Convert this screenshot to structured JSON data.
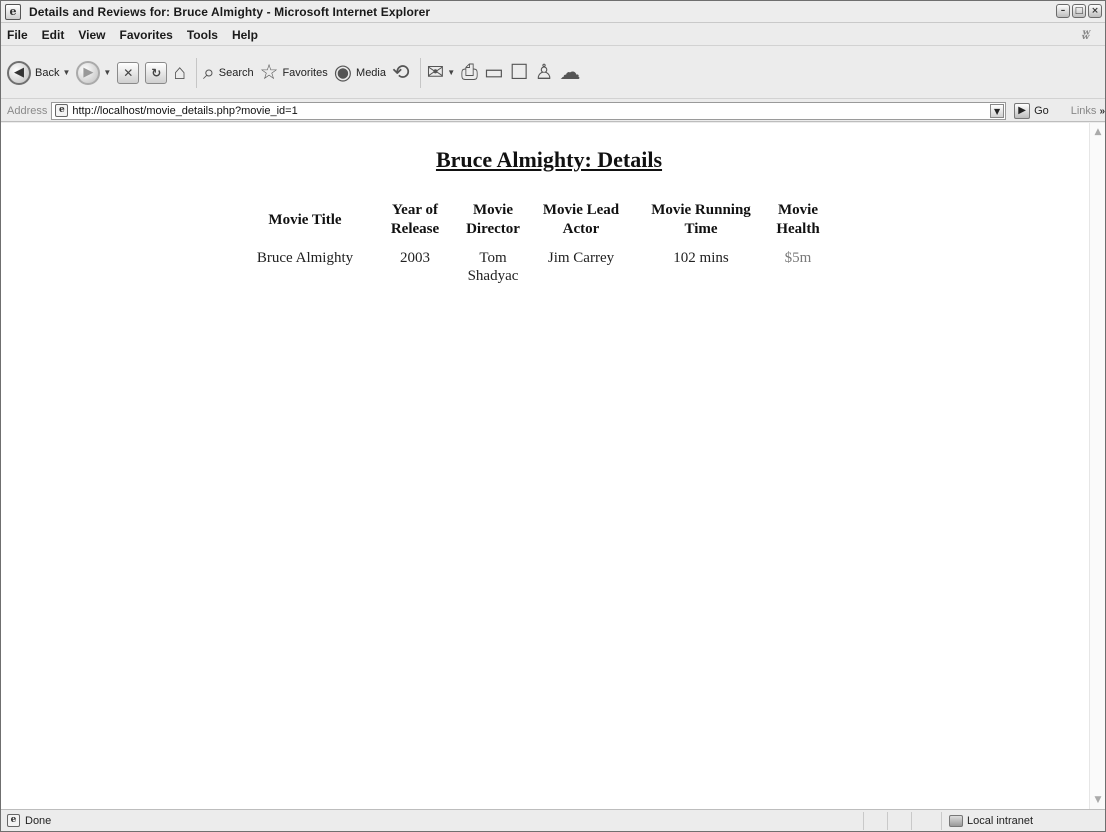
{
  "window": {
    "title": "Details and Reviews for: Bruce Almighty - Microsoft Internet Explorer",
    "app_icon": "e",
    "minimize": "–",
    "maximize": "□",
    "close": "×"
  },
  "menu": {
    "items": [
      "File",
      "Edit",
      "View",
      "Favorites",
      "Tools",
      "Help"
    ],
    "windows_flag": "ʬ"
  },
  "toolbar": {
    "back_label": "Back",
    "back_glyph": "◀",
    "forward_glyph": "▶",
    "stop_glyph": "✕",
    "refresh_glyph": "↻",
    "home_glyph": "⌂",
    "search_label": "Search",
    "search_glyph": "⌕",
    "favorites_label": "Favorites",
    "favorites_glyph": "☆",
    "media_label": "Media",
    "media_glyph": "◉",
    "history_glyph": "⟲",
    "mail_glyph": "✉",
    "print_glyph": "⎙",
    "edit_glyph": "▭",
    "discuss_glyph": "☐",
    "messenger_glyph": "♙",
    "research_glyph": "☁",
    "dropdown": "▼"
  },
  "address": {
    "label": "Address",
    "url": "http://localhost/movie_details.php?movie_id=1",
    "go_label": "Go",
    "links_label": "Links",
    "links_chevron": "»",
    "page_glyph": "e"
  },
  "page": {
    "heading": "Bruce Almighty: Details",
    "columns": [
      "Movie Title",
      "Year of Release",
      "Movie Director",
      "Movie Lead Actor",
      "Movie Running Time",
      "Movie Health"
    ],
    "rows": [
      [
        "Bruce Almighty",
        "2003",
        "Tom Shadyac",
        "Jim Carrey",
        "102 mins",
        "$5m"
      ]
    ]
  },
  "scrollbar": {
    "up": "▲",
    "down": "▼"
  },
  "status": {
    "text": "Done",
    "zone": "Local intranet",
    "page_glyph": "e"
  },
  "colors": {
    "chrome": "#ececec",
    "text": "#111111",
    "health_text": "#7a7a7a"
  }
}
